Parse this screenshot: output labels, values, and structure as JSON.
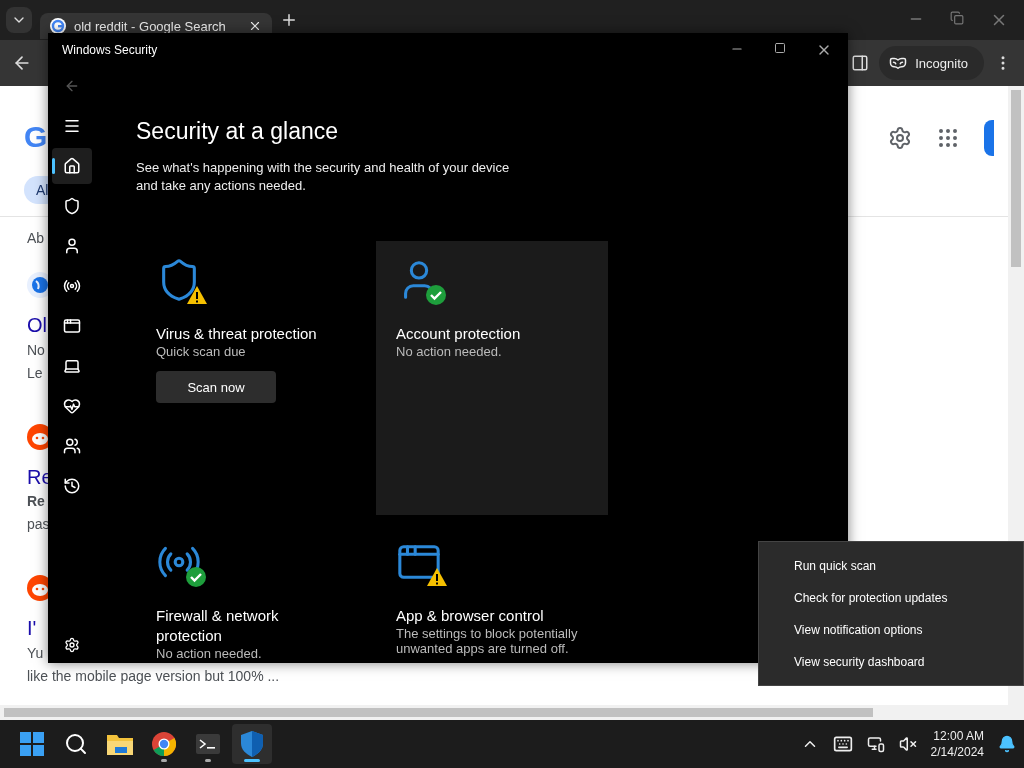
{
  "browser": {
    "tab": {
      "title": "old reddit - Google Search",
      "selected": true
    },
    "profile": "Incognito",
    "page": {
      "logo": "G",
      "chip": "Al",
      "fragments": [
        {
          "kind": "about",
          "text": "Ab"
        },
        {
          "kind": "globe"
        },
        {
          "kind": "title",
          "text": "Ol"
        },
        {
          "kind": "snippet",
          "text": "No"
        },
        {
          "kind": "snippet",
          "text": "Le"
        },
        {
          "kind": "reddit"
        },
        {
          "kind": "title",
          "text": "Re"
        },
        {
          "kind": "bold",
          "text": "Re"
        },
        {
          "kind": "snippet",
          "text": "pas"
        },
        {
          "kind": "reddit"
        },
        {
          "kind": "title",
          "text": "I'"
        },
        {
          "kind": "snippet",
          "text": "Yu"
        },
        {
          "kind": "snippet",
          "text": "like the mobile page version but 100% ..."
        }
      ]
    }
  },
  "security_window": {
    "title": "Windows Security",
    "nav": [
      {
        "kind": "menu",
        "selected": false
      },
      {
        "kind": "home",
        "selected": true
      },
      {
        "kind": "shield",
        "selected": false
      },
      {
        "kind": "account",
        "selected": false
      },
      {
        "kind": "network",
        "selected": false
      },
      {
        "kind": "app",
        "selected": false
      },
      {
        "kind": "device",
        "selected": false
      },
      {
        "kind": "health",
        "selected": false
      },
      {
        "kind": "family",
        "selected": false
      },
      {
        "kind": "history",
        "selected": false
      }
    ],
    "heading": "Security at a glance",
    "description": "See what's happening with the security and health of your device and take any actions needed.",
    "cards": [
      {
        "kind": "virus",
        "warning": true,
        "highlighted": false,
        "title": "Virus & threat protection",
        "subtitle": "Quick scan due",
        "button": "Scan now"
      },
      {
        "kind": "account",
        "warning": false,
        "highlighted": true,
        "title": "Account protection",
        "subtitle": "No action needed."
      },
      {
        "kind": "network",
        "warning": false,
        "highlighted": false,
        "title": "Firewall & network protection",
        "subtitle": "No action needed."
      },
      {
        "kind": "app",
        "warning": true,
        "highlighted": false,
        "title": "App & browser control",
        "subtitle": "The settings to block potentially unwanted apps are turned off."
      }
    ]
  },
  "context_menu": [
    "Run quick scan",
    "Check for protection updates",
    "View notification options",
    "View security dashboard"
  ],
  "taskbar": {
    "apps": [
      {
        "kind": "start",
        "running": false,
        "selected": false
      },
      {
        "kind": "search",
        "running": false,
        "selected": false
      },
      {
        "kind": "explorer",
        "running": false,
        "selected": false
      },
      {
        "kind": "chrome",
        "running": true,
        "selected": false
      },
      {
        "kind": "terminal",
        "running": true,
        "selected": false
      },
      {
        "kind": "security",
        "running": true,
        "selected": true
      }
    ],
    "time": "12:00 AM",
    "date": "2/14/2024"
  }
}
